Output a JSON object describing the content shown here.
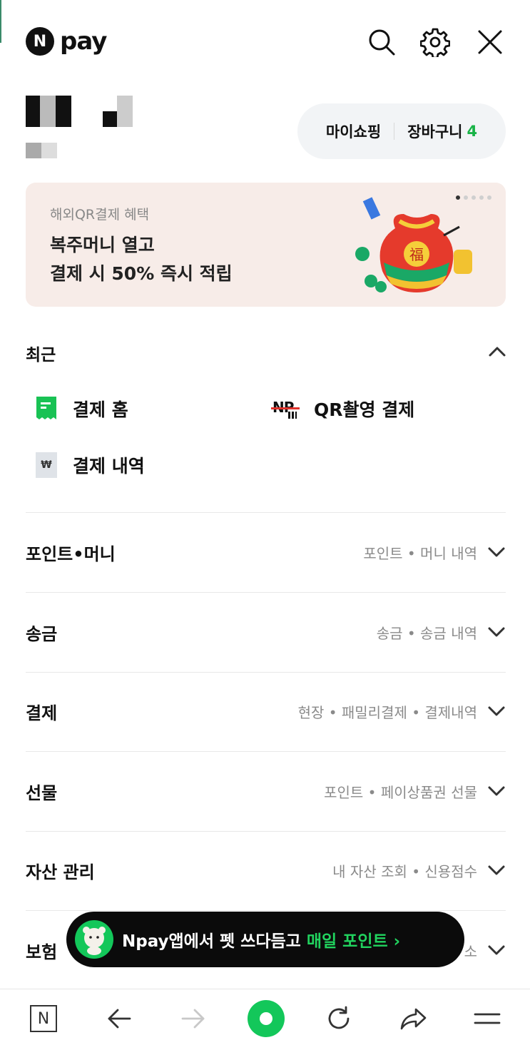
{
  "header": {
    "logo_letter": "N",
    "logo_text": "pay",
    "icons": [
      "search-icon",
      "gear-icon",
      "close-icon"
    ]
  },
  "profile": {
    "my_shopping": "마이쇼핑",
    "cart_label": "장바구니",
    "cart_count": "4"
  },
  "banner": {
    "subtitle": "해외QR결제 혜택",
    "title_line1": "복주머니 열고",
    "title_line2": "결제 시 50% 즉시 적립",
    "seal_char": "福"
  },
  "recent": {
    "title": "최근",
    "items": [
      {
        "label": "결제 홈",
        "icon": "receipt-green-icon"
      },
      {
        "label": "QR촬영 결제",
        "icon": "qr-np-icon",
        "icon_text": "NP"
      },
      {
        "label": "결제 내역",
        "icon": "won-receipt-icon",
        "icon_text": "₩"
      }
    ]
  },
  "menu": [
    {
      "title": "포인트•머니",
      "detail": "포인트 • 머니 내역"
    },
    {
      "title": "송금",
      "detail": "송금 • 송금 내역"
    },
    {
      "title": "결제",
      "detail": "현장 • 패밀리결제 • 결제내역"
    },
    {
      "title": "선물",
      "detail": "포인트 • 페이상품권 선물"
    },
    {
      "title": "자산 관리",
      "detail": "내 자산 조회 • 신용점수"
    },
    {
      "title": "보험",
      "detail": "소"
    }
  ],
  "toast": {
    "text": "Npay앱에서 펫 쓰다듬고",
    "highlight": "매일 포인트 ›"
  },
  "bottom_bar": {
    "home_letter": "N",
    "icons": [
      "naver-home-icon",
      "back-arrow-icon",
      "forward-arrow-icon",
      "green-circle-icon",
      "refresh-icon",
      "share-icon",
      "menu-icon"
    ]
  },
  "colors": {
    "accent": "#19b347",
    "banner_bg": "#f7ece8",
    "toast_bg": "#0b0b0b"
  }
}
